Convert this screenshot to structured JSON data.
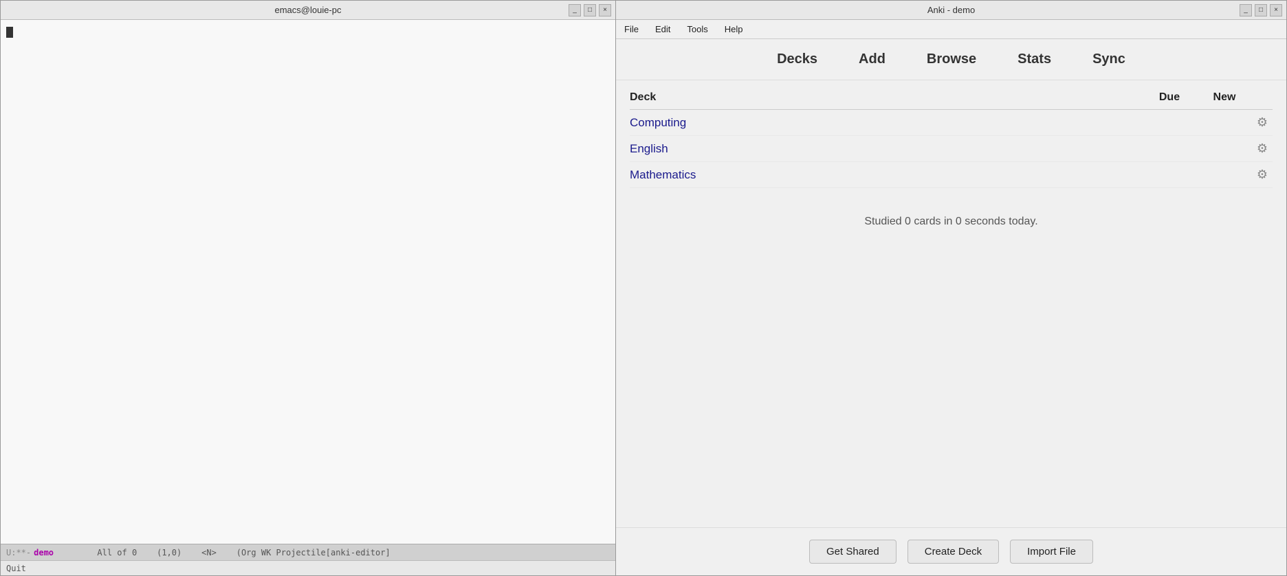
{
  "emacs": {
    "title": "emacs@louie-pc",
    "controls": [
      "_",
      "□",
      "×"
    ],
    "statusbar": {
      "mode": "U:**-",
      "buffer": "demo",
      "position": "All of 0",
      "coords": "(1,0)",
      "extra": "<N>",
      "mode_line": "(Org WK Projectile[anki-editor]"
    },
    "modeline": "Quit"
  },
  "anki": {
    "title": "Anki - demo",
    "controls": [
      "_",
      "□",
      "×"
    ],
    "menu": {
      "items": [
        "File",
        "Edit",
        "Tools",
        "Help"
      ]
    },
    "toolbar": {
      "buttons": [
        "Decks",
        "Add",
        "Browse",
        "Stats",
        "Sync"
      ]
    },
    "deck_table": {
      "headers": {
        "deck": "Deck",
        "due": "Due",
        "new": "New"
      },
      "rows": [
        {
          "name": "Computing",
          "due": "",
          "new": ""
        },
        {
          "name": "English",
          "due": "",
          "new": ""
        },
        {
          "name": "Mathematics",
          "due": "",
          "new": ""
        }
      ]
    },
    "studied_text": "Studied 0 cards in 0 seconds today.",
    "footer": {
      "buttons": [
        "Get Shared",
        "Create Deck",
        "Import File"
      ]
    }
  }
}
